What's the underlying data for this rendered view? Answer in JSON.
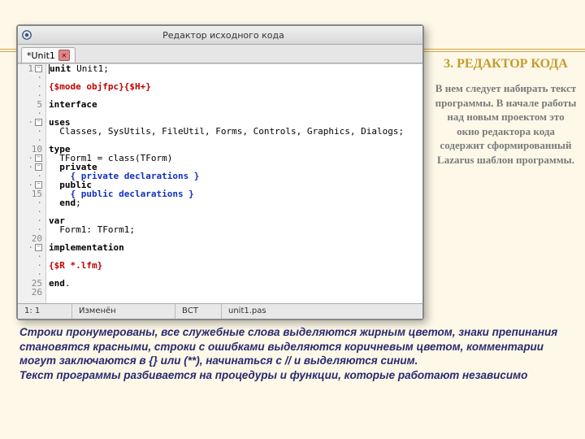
{
  "window": {
    "title": "Редактор исходного кода",
    "tab": "*Unit1",
    "close_glyph": "✕"
  },
  "gutter": {
    "l1": "1",
    "l5": "5",
    "l10": "10",
    "l15": "15",
    "l20": "20",
    "l25": "25",
    "l26": "26",
    "dot": "·",
    "minus": "−"
  },
  "code": {
    "l1a": "unit",
    "l1b": " Unit1;",
    "l3": "{$mode objfpc}{$H+}",
    "l5": "interface",
    "l7": "uses",
    "l8": "  Classes, SysUtils, FileUtil, Forms, Controls, Graphics, Dialogs;",
    "l10": "type",
    "l11": "  TForm1 = class(TForm)",
    "l12a": "  private",
    "l13": "    { private declarations }",
    "l14a": "  public",
    "l15": "    { public declarations }",
    "l16a": "  end",
    "l16b": ";",
    "l18": "var",
    "l19": "  Form1: TForm1;",
    "l21": "implementation",
    "l23": "{$R *.lfm}",
    "l25a": "end",
    "l25b": "."
  },
  "status": {
    "pos": "1: 1",
    "state": "Изменён",
    "mode": "ВСТ",
    "file": "unit1.pas"
  },
  "right": {
    "title": "3. РЕДАКТОР КОДА",
    "body": "В нем следует набирать текст программы.\nВ начале работы над новым проектом это окно редактора кода содержит сформированный Lazarus шаблон программы."
  },
  "bottom": {
    "p1": "Строки пронумерованы, все служебные слова выделяются жирным цветом, знаки препинания становятся красными, строки с ошибками выделяются коричневым цветом, комментарии  могут заключаются в {} или (**), начинаться с // и выделяются синим.",
    "p2": "Текст программы разбивается на процедуры и функции, которые работают независимо"
  }
}
